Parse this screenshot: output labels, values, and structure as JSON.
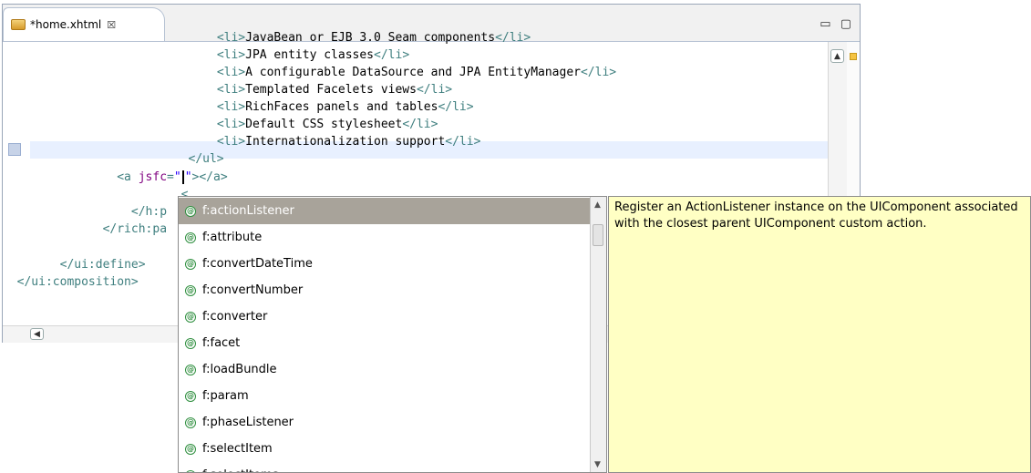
{
  "editor": {
    "tab_title": "*home.xhtml",
    "tab_close": "☒",
    "window_controls": "▭ ▢",
    "code_lines": [
      {
        "indent": "                              ",
        "parts": [
          {
            "t": "tag",
            "s": "<li>"
          },
          {
            "t": "txt",
            "s": "JavaBean or EJB 3.0 Seam components"
          },
          {
            "t": "tag",
            "s": "</li>"
          }
        ]
      },
      {
        "indent": "                              ",
        "parts": [
          {
            "t": "tag",
            "s": "<li>"
          },
          {
            "t": "txt",
            "s": "JPA entity classes"
          },
          {
            "t": "tag",
            "s": "</li>"
          }
        ]
      },
      {
        "indent": "                              ",
        "parts": [
          {
            "t": "tag",
            "s": "<li>"
          },
          {
            "t": "txt",
            "s": "A configurable DataSource and JPA EntityManager"
          },
          {
            "t": "tag",
            "s": "</li>"
          }
        ]
      },
      {
        "indent": "                              ",
        "parts": [
          {
            "t": "tag",
            "s": "<li>"
          },
          {
            "t": "txt",
            "s": "Templated Facelets views"
          },
          {
            "t": "tag",
            "s": "</li>"
          }
        ]
      },
      {
        "indent": "                              ",
        "parts": [
          {
            "t": "tag",
            "s": "<li>"
          },
          {
            "t": "txt",
            "s": "RichFaces panels and tables"
          },
          {
            "t": "tag",
            "s": "</li>"
          }
        ]
      },
      {
        "indent": "                              ",
        "parts": [
          {
            "t": "tag",
            "s": "<li>"
          },
          {
            "t": "txt",
            "s": "Default CSS stylesheet"
          },
          {
            "t": "tag",
            "s": "</li>"
          }
        ]
      },
      {
        "indent": "                              ",
        "parts": [
          {
            "t": "tag",
            "s": "<li>"
          },
          {
            "t": "txt",
            "s": "Internationalization support"
          },
          {
            "t": "tag",
            "s": "</li>"
          }
        ]
      },
      {
        "indent": "                          ",
        "parts": [
          {
            "t": "tag",
            "s": "</ul>"
          }
        ]
      },
      {
        "indent": "                ",
        "parts": [
          {
            "t": "tag",
            "s": "<a "
          },
          {
            "t": "attr",
            "s": "jsfc"
          },
          {
            "t": "tag",
            "s": "="
          },
          {
            "t": "val",
            "s": "\""
          },
          {
            "t": "caret",
            "s": ""
          },
          {
            "t": "val",
            "s": "\""
          },
          {
            "t": "tag",
            "s": "></a>"
          }
        ]
      },
      {
        "indent": "                         ",
        "parts": [
          {
            "t": "tag",
            "s": "<"
          }
        ]
      },
      {
        "indent": "                  ",
        "parts": [
          {
            "t": "tag",
            "s": "</h:p"
          }
        ]
      },
      {
        "indent": "              ",
        "parts": [
          {
            "t": "tag",
            "s": "</rich:pa"
          }
        ]
      },
      {
        "indent": "",
        "parts": []
      },
      {
        "indent": "        ",
        "parts": [
          {
            "t": "tag",
            "s": "</ui:define>"
          }
        ]
      },
      {
        "indent": "  ",
        "parts": [
          {
            "t": "tag",
            "s": "</ui:composition>"
          }
        ]
      }
    ]
  },
  "completion": {
    "items": [
      "f:actionListener",
      "f:attribute",
      "f:convertDateTime",
      "f:convertNumber",
      "f:converter",
      "f:facet",
      "f:loadBundle",
      "f:param",
      "f:phaseListener",
      "f:selectItem",
      "f:selectItems"
    ],
    "selected_index": 0,
    "item_icon": "tag-icon",
    "description": "Register an ActionListener instance on the UIComponent associated with the closest parent UIComponent custom action."
  },
  "colors": {
    "tag": "#3f7f7f",
    "attr": "#7f007f",
    "value": "#2a00ff",
    "selection": "#a8a39a",
    "info_bg": "#ffffc4"
  }
}
